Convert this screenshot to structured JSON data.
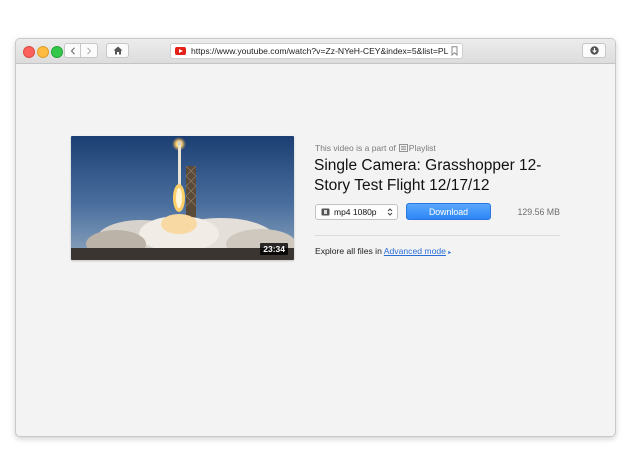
{
  "browser": {
    "url": "https://www.youtube.com/watch?v=Zz-NYeH-CEY&index=5&list=PL...",
    "icons": {
      "back": "chevron-left-icon",
      "forward": "chevron-right-icon",
      "home": "home-icon",
      "site": "youtube-icon",
      "bookmark": "bookmark-icon",
      "download": "download-icon"
    }
  },
  "video": {
    "part_of_prefix": "This video is a part of",
    "playlist_label": "Playlist",
    "title": "Single Camera: Grasshopper 12-Story Test Flight 12/17/12",
    "duration": "23:34"
  },
  "download": {
    "format": "mp4 1080p",
    "button_label": "Download",
    "file_size": "129.56 MB"
  },
  "explore": {
    "text": "Explore all files in",
    "link": "Advanced mode"
  },
  "colors": {
    "accent": "#2e86f5",
    "link": "#2b6fd6",
    "youtube_red": "#e62117"
  }
}
